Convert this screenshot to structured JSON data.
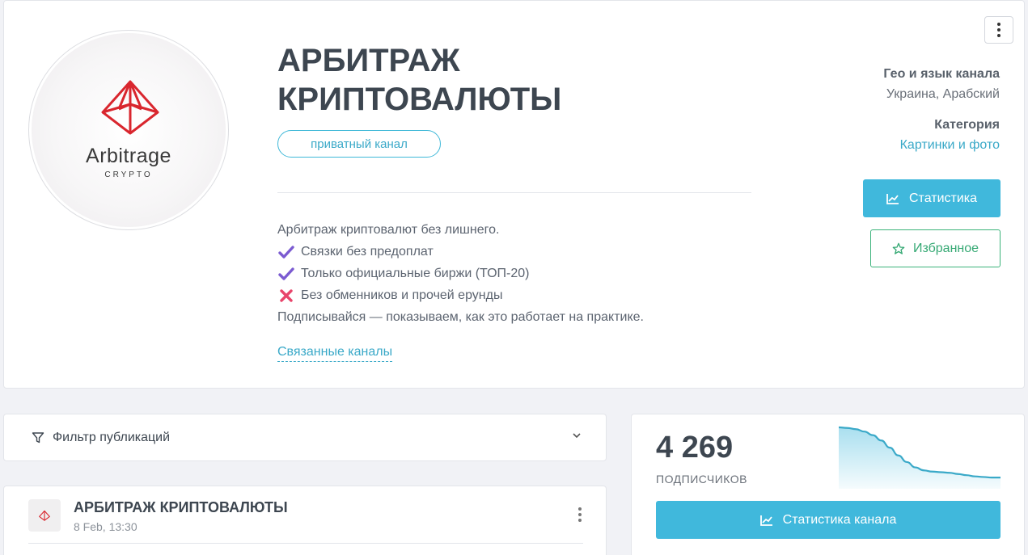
{
  "channel": {
    "title": "АРБИТРАЖ КРИПТОВАЛЮТЫ",
    "type_badge": "приватный канал",
    "avatar_brand": "Arbitrage",
    "avatar_brand_sub": "CRYPTO",
    "description": [
      {
        "icon": "",
        "text": "Арбитраж криптовалют без лишнего."
      },
      {
        "icon": "check-mark-icon",
        "text": "Связки без предоплат"
      },
      {
        "icon": "check-mark-icon",
        "text": "Только официальные биржи (ТОП-20)"
      },
      {
        "icon": "cross-mark-icon",
        "text": "Без обменников и прочей ерунды"
      },
      {
        "icon": "",
        "text": "Подписывайся — показываем, как это работает на практике."
      }
    ],
    "related_link": "Связанные каналы"
  },
  "meta": {
    "geo_label": "Гео и язык канала",
    "geo_value": "Украина, Арабский",
    "category_label": "Категория",
    "category_value": "Картинки и фото"
  },
  "actions": {
    "stats_label": "Статистика",
    "favorite_label": "Избранное"
  },
  "filter": {
    "label": "Фильтр публикаций"
  },
  "post": {
    "title": "АРБИТРАЖ КРИПТОВАЛЮТЫ",
    "date": "8 Feb, 13:30"
  },
  "subscribers": {
    "count": "4 269",
    "label": "ПОДПИСЧИКОВ",
    "button_label": "Статистика канала",
    "trend": [
      100,
      99,
      97,
      93,
      87,
      78,
      66,
      53,
      42,
      33,
      28,
      26,
      25,
      24,
      22,
      20,
      18,
      17,
      16,
      16
    ]
  },
  "colors": {
    "accent": "#40b8dc",
    "favorite": "#36a974",
    "logo": "#d9262e"
  }
}
